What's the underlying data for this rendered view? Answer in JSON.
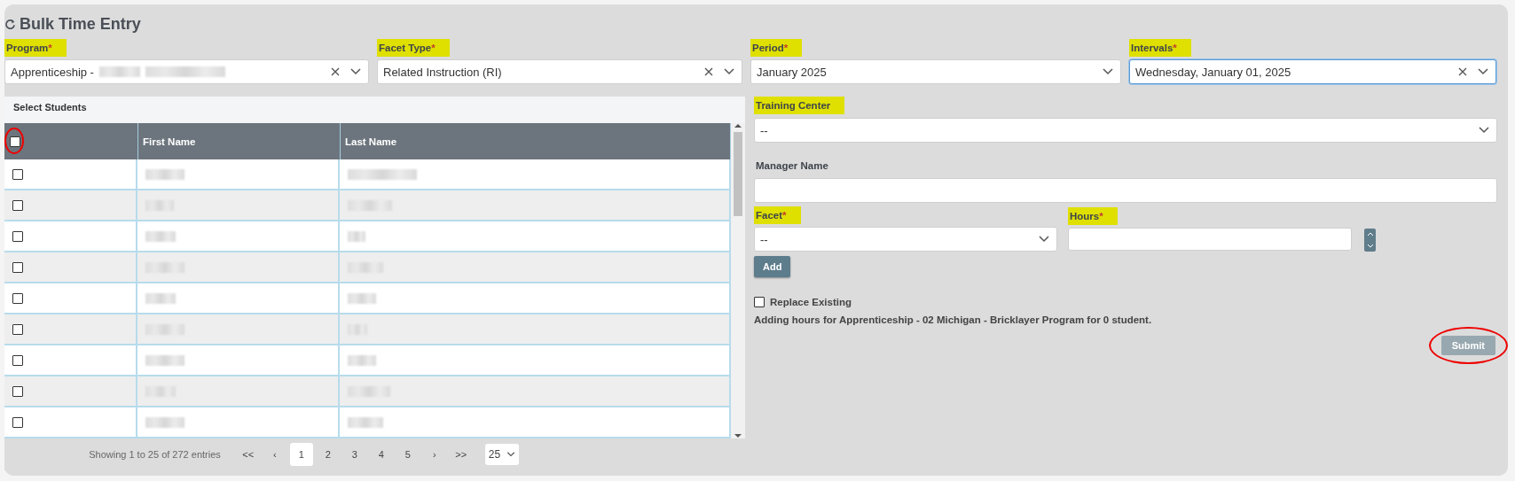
{
  "title": "Bulk Time Entry",
  "filters": [
    {
      "kind": "select",
      "label": "Program",
      "required_mark": "*",
      "highlighted": true,
      "value": "Apprenticeship -",
      "redacted": true,
      "clearable": true,
      "focused": false
    },
    {
      "kind": "select",
      "label": "Facet Type",
      "required_mark": "*",
      "highlighted": true,
      "value": "Related Instruction (RI)",
      "redacted": false,
      "clearable": true,
      "focused": false
    },
    {
      "kind": "select",
      "label": "Period",
      "required_mark": "*",
      "highlighted": true,
      "value": "January 2025",
      "redacted": false,
      "clearable": false,
      "focused": false
    },
    {
      "kind": "select",
      "label": "Intervals",
      "required_mark": "*",
      "highlighted": true,
      "value": "Wednesday, January 01, 2025",
      "redacted": false,
      "clearable": true,
      "focused": true
    }
  ],
  "students": {
    "title": "Select Students",
    "select_all": {
      "checked": false,
      "circled": true
    },
    "columns": [
      "First Name",
      "Last Name"
    ],
    "rows": [
      {
        "checked": false
      },
      {
        "checked": false
      },
      {
        "checked": false
      },
      {
        "checked": false
      },
      {
        "checked": false
      },
      {
        "checked": false
      },
      {
        "checked": false
      },
      {
        "checked": false
      },
      {
        "checked": false
      }
    ],
    "footer": {
      "info": "Showing 1 to 25 of 272 entries",
      "first": "<<",
      "prev": "‹",
      "pages": [
        {
          "label": "1",
          "selected": true
        },
        {
          "label": "2",
          "selected": false
        },
        {
          "label": "3",
          "selected": false
        },
        {
          "label": "4",
          "selected": false
        },
        {
          "label": "5",
          "selected": false
        }
      ],
      "next": "›",
      "last": ">>",
      "page_size": "25"
    }
  },
  "form": {
    "training_center": {
      "label": "Training Center",
      "highlighted": true,
      "value": "--"
    },
    "manager_name": {
      "label": "Manager Name",
      "highlighted": false
    },
    "facet": {
      "label": "Facet",
      "required_mark": "*",
      "highlighted": true,
      "value": "--"
    },
    "hours": {
      "label": "Hours",
      "required_mark": "*",
      "highlighted": true
    },
    "add_button": "Add",
    "replace_existing": {
      "label": "Replace Existing",
      "checked": false
    },
    "summary": "Adding hours for Apprenticeship - 02 Michigan - Bricklayer Program for 0 student.",
    "submit": {
      "label": "Submit",
      "disabled": true,
      "circled": true
    }
  }
}
